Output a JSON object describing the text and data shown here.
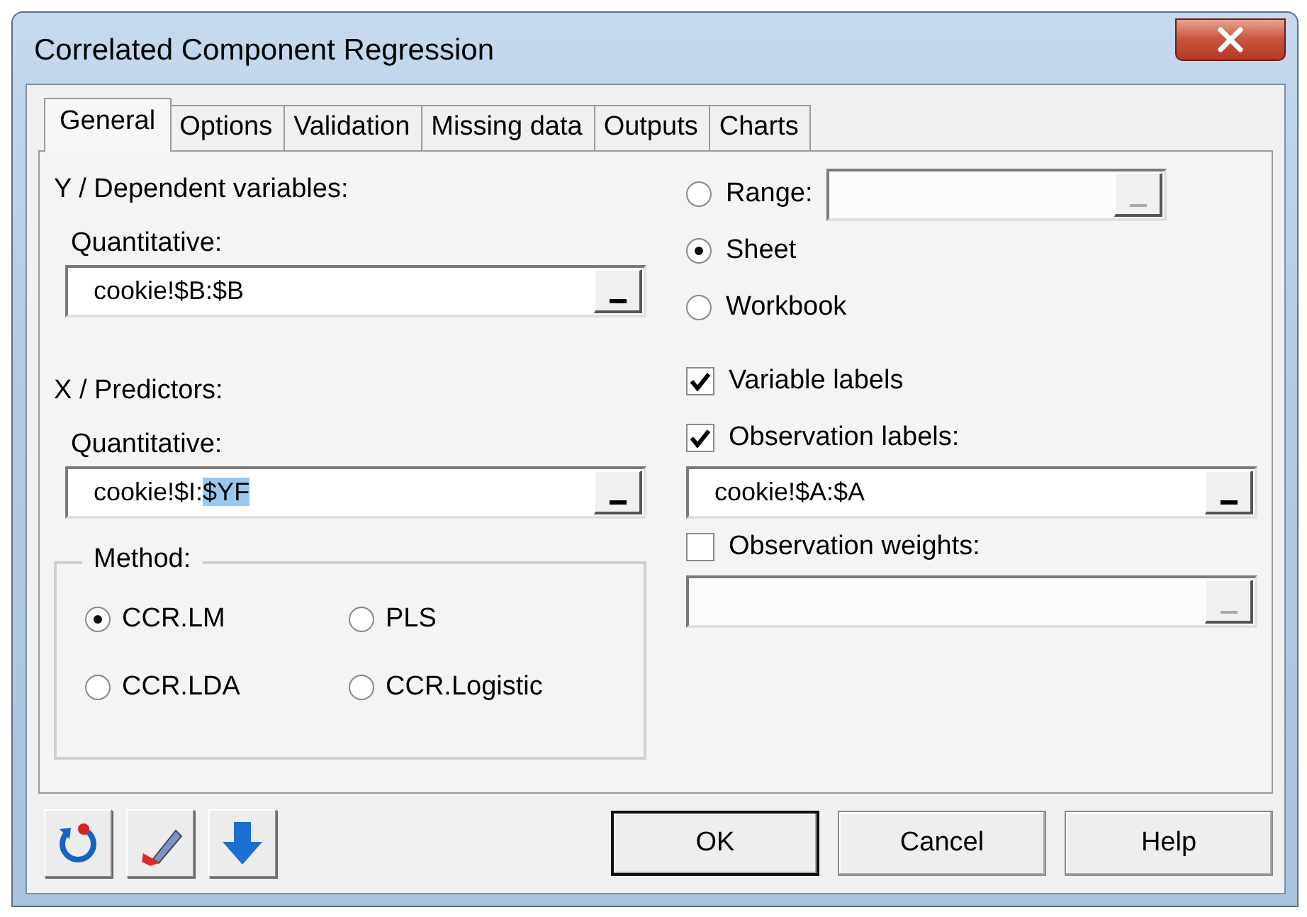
{
  "window": {
    "title": "Correlated Component Regression"
  },
  "tabs": [
    {
      "label": "General",
      "selected": true
    },
    {
      "label": "Options",
      "selected": false
    },
    {
      "label": "Validation",
      "selected": false
    },
    {
      "label": "Missing data",
      "selected": false
    },
    {
      "label": "Outputs",
      "selected": false
    },
    {
      "label": "Charts",
      "selected": false
    }
  ],
  "dependent": {
    "heading": "Y / Dependent variables:",
    "label": "Quantitative:",
    "field": {
      "value": "cookie!$B:$B",
      "disabled": false
    }
  },
  "predictors": {
    "heading": "X / Predictors:",
    "label": "Quantitative:",
    "field": {
      "value": "cookie!$I:",
      "selected_text": "$YF",
      "disabled": false
    }
  },
  "method": {
    "title": "Method:",
    "options": [
      {
        "label": "CCR.LM",
        "selected": true
      },
      {
        "label": "PLS",
        "selected": false
      },
      {
        "label": "CCR.LDA",
        "selected": false
      },
      {
        "label": "CCR.Logistic",
        "selected": false
      }
    ]
  },
  "output_target": [
    {
      "label": "Range:",
      "selected": false,
      "field": {
        "disabled": true
      }
    },
    {
      "label": "Sheet",
      "selected": true
    },
    {
      "label": "Workbook",
      "selected": false
    }
  ],
  "options": [
    {
      "label": "Variable labels",
      "checked": true
    },
    {
      "label": "Observation labels:",
      "checked": true,
      "field": {
        "value": "cookie!$A:$A",
        "disabled": false
      }
    },
    {
      "label": "Observation weights:",
      "checked": false,
      "field": {
        "disabled": true
      }
    }
  ],
  "buttons": [
    {
      "label": "OK",
      "default": true
    },
    {
      "label": "Cancel",
      "default": false
    },
    {
      "label": "Help",
      "default": false
    }
  ]
}
